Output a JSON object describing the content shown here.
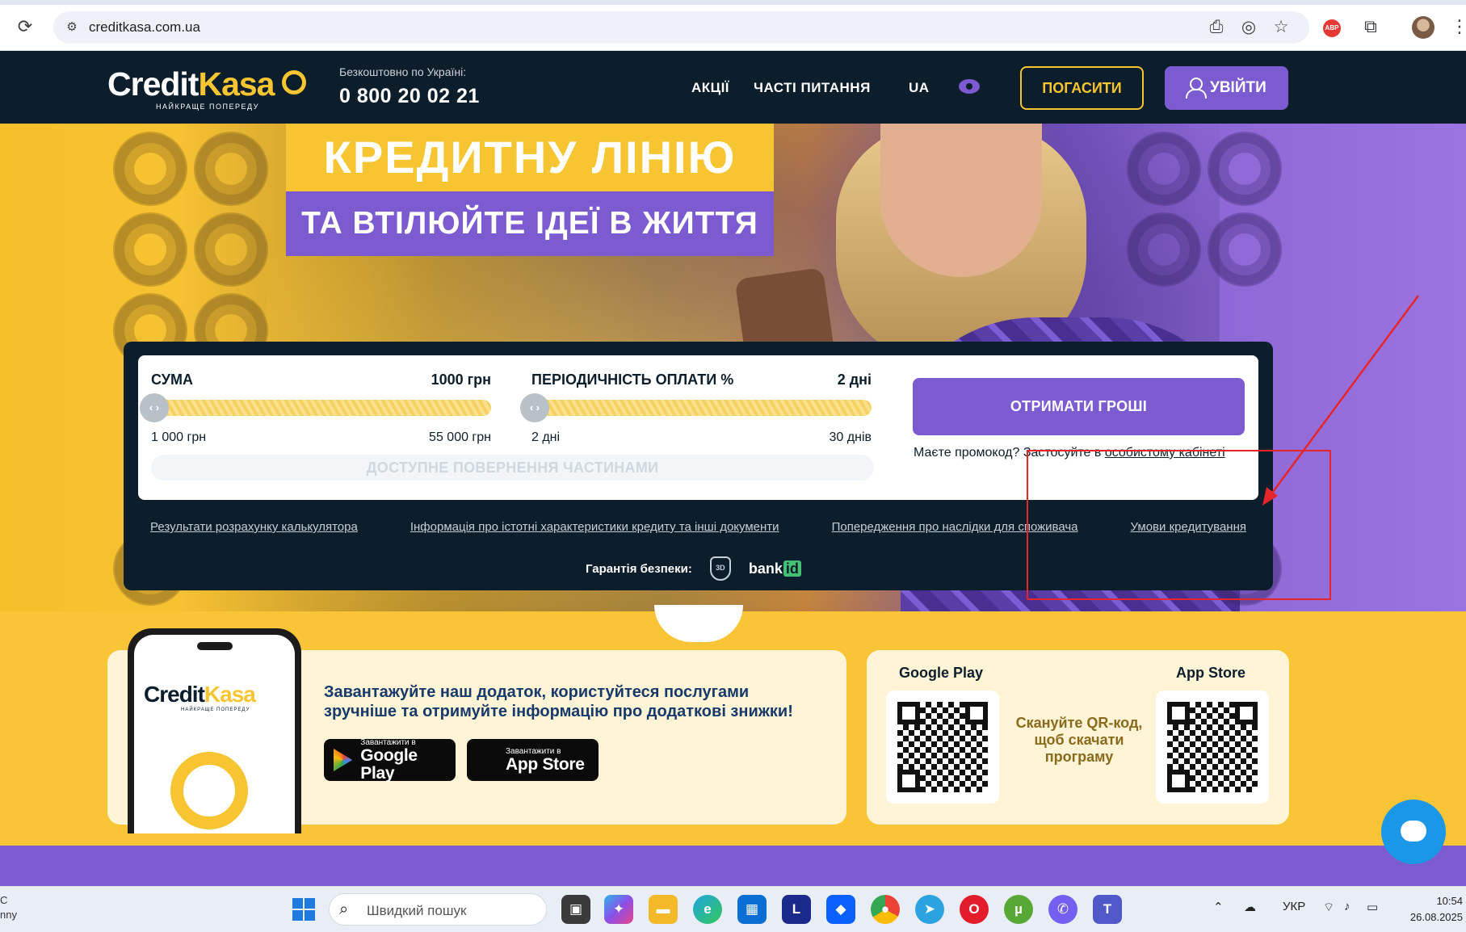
{
  "browser": {
    "url": "creditkasa.com.ua",
    "ext_abp": "ABP"
  },
  "header": {
    "logo_credit": "Credit",
    "logo_kasa": "Kasa",
    "logo_tagline": "НАЙКРАЩЕ ПОПЕРЕДУ",
    "phone_label": "Безкоштовно по Україні:",
    "phone_number": "0 800 20 02 21",
    "nav": [
      "АКЦІЇ",
      "ЧАСТІ ПИТАННЯ",
      "UA"
    ],
    "repay_label": "ПОГАСИТИ",
    "login_label": "УВІЙТИ"
  },
  "hero": {
    "headline_1": "КРЕДИТНУ ЛІНІЮ",
    "headline_2": "ТА ВТІЛЮЙТЕ ІДЕЇ В ЖИТТЯ"
  },
  "calculator": {
    "sum_label": "СУМА",
    "sum_value": "1000 грн",
    "sum_min": "1 000 грн",
    "sum_max": "55 000 грн",
    "period_label": "ПЕРІОДИЧНІСТЬ ОПЛАТИ %",
    "period_value": "2 дні",
    "period_min": "2 дні",
    "period_max": "30 днів",
    "partial_label": "ДОСТУПНЕ ПОВЕРНЕННЯ ЧАСТИНАМИ",
    "get_money_label": "ОТРИМАТИ ГРОШІ",
    "promo_text": "Маєте промокод? Застосуйте в ",
    "promo_link": "особистому кабінеті",
    "links": [
      "Результати розрахунку калькулятора",
      "Інформація про істотні характеристики кредиту та інші документи",
      "Попередження про наслідки для споживача",
      "Умови кредитування"
    ],
    "security_label": "Гарантія безпеки:",
    "shield_text": "3D",
    "bankid_bank": "bank",
    "bankid_id": "id"
  },
  "app": {
    "promo_text": "Завантажуйте наш додаток, користуйтеся послугами зручніше та отримуйте інформацію про додаткові знижки!",
    "google_small": "Завантажити в",
    "google_big": "Google Play",
    "apple_small": "Завантажити в",
    "apple_big": "App Store",
    "qr_google_title": "Google Play",
    "qr_apple_title": "App Store",
    "qr_caption": "Скануйте QR-код, щоб скачати програму",
    "phone_logo_credit": "Credit",
    "phone_logo_kasa": "Kasa",
    "phone_tagline": "НАЙКРАЩЕ ПОПЕРЕДУ"
  },
  "taskbar": {
    "weather_line1": "С",
    "weather_line2": "nny",
    "search_placeholder": "Швидкий пошук",
    "language": "УКР",
    "time": "10:54",
    "date": "26.08.2025"
  },
  "colors": {
    "dark_navy": "#0c1d2b",
    "yellow": "#f7c531",
    "purple": "#7c5bd1",
    "annotation_red": "#e4262a"
  }
}
